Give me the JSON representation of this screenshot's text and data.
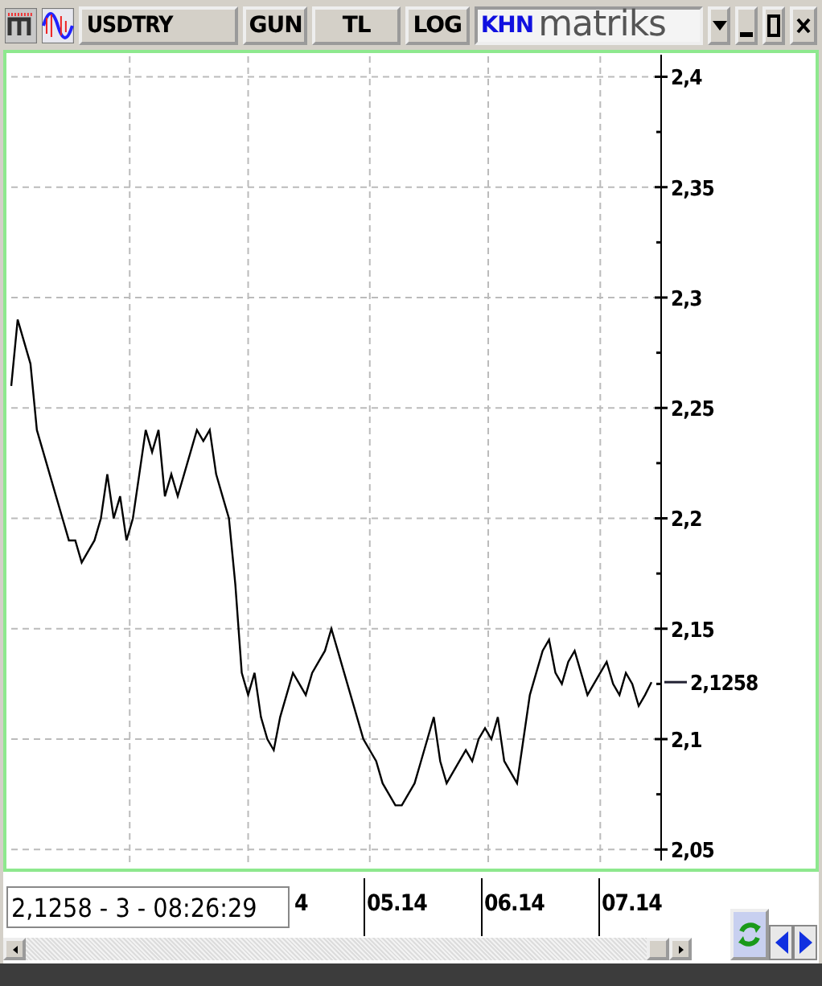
{
  "toolbar": {
    "symbol": "USDTRY",
    "buttons": [
      "GUN",
      "TL",
      "LOG"
    ],
    "mode": "KHN",
    "brand": "matriks"
  },
  "chart": {
    "last_label": "2,1258",
    "chart_data": {
      "type": "line",
      "grid": true,
      "ylim": [
        2.045,
        2.41
      ],
      "yticks": [
        {
          "value": 2.05,
          "label": "2,05"
        },
        {
          "value": 2.1,
          "label": "2,1"
        },
        {
          "value": 2.15,
          "label": "2,15"
        },
        {
          "value": 2.2,
          "label": "2,2"
        },
        {
          "value": 2.25,
          "label": "2,25"
        },
        {
          "value": 2.3,
          "label": "2,3"
        },
        {
          "value": 2.35,
          "label": "2,35"
        },
        {
          "value": 2.4,
          "label": "2,4"
        }
      ],
      "series": [
        {
          "color": "#000000",
          "values": [
            2.26,
            2.29,
            2.28,
            2.27,
            2.24,
            2.23,
            2.22,
            2.21,
            2.2,
            2.19,
            2.19,
            2.18,
            2.185,
            2.19,
            2.2,
            2.22,
            2.2,
            2.21,
            2.19,
            2.2,
            2.22,
            2.24,
            2.23,
            2.24,
            2.21,
            2.22,
            2.21,
            2.22,
            2.23,
            2.24,
            2.235,
            2.24,
            2.22,
            2.21,
            2.2,
            2.17,
            2.13,
            2.12,
            2.13,
            2.11,
            2.1,
            2.095,
            2.11,
            2.12,
            2.13,
            2.125,
            2.12,
            2.13,
            2.135,
            2.14,
            2.15,
            2.14,
            2.13,
            2.12,
            2.11,
            2.1,
            2.095,
            2.09,
            2.08,
            2.075,
            2.07,
            2.07,
            2.075,
            2.08,
            2.09,
            2.1,
            2.11,
            2.09,
            2.08,
            2.085,
            2.09,
            2.095,
            2.09,
            2.1,
            2.105,
            2.1,
            2.11,
            2.09,
            2.085,
            2.08,
            2.1,
            2.12,
            2.13,
            2.14,
            2.145,
            2.13,
            2.125,
            2.135,
            2.14,
            2.13,
            2.12,
            2.125,
            2.13,
            2.135,
            2.125,
            2.12,
            2.13,
            2.125,
            2.115,
            2.12,
            2.1258
          ]
        }
      ]
    }
  },
  "bottom": {
    "partial_label": "4",
    "month_labels": [
      "05.14",
      "06.14",
      "07.14"
    ],
    "readout": "2,1258 - 3 - 08:26:29"
  }
}
